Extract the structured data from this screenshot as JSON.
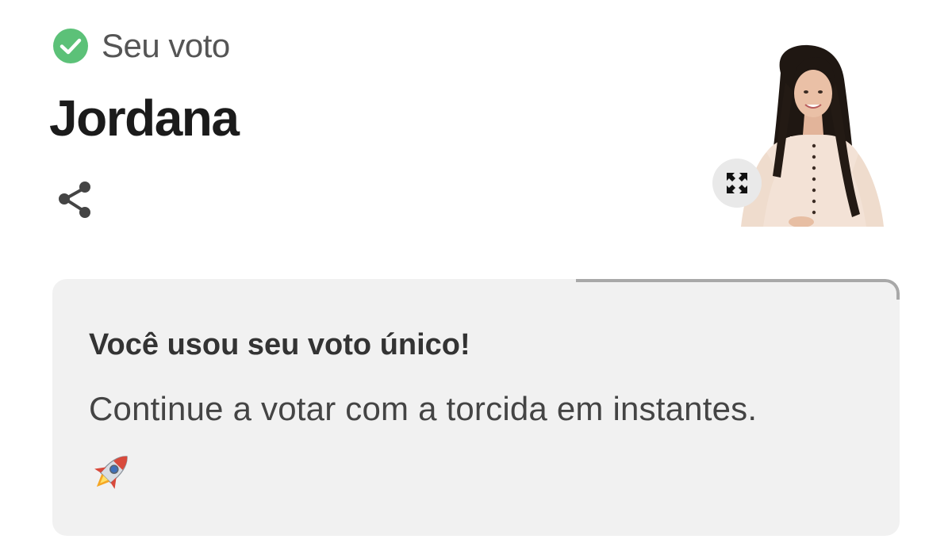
{
  "vote": {
    "label": "Seu voto",
    "candidate_name": "Jordana"
  },
  "card": {
    "title": "Você usou seu voto único!",
    "message": "Continue a votar com a torcida em instantes.",
    "emoji": "rocket-icon"
  },
  "icons": {
    "check": "check-circle-icon",
    "share": "share-icon",
    "expand": "expand-icon"
  },
  "colors": {
    "check_green": "#5cc178",
    "card_background": "#f1f1f1",
    "text_dark": "#1b1b1b"
  }
}
